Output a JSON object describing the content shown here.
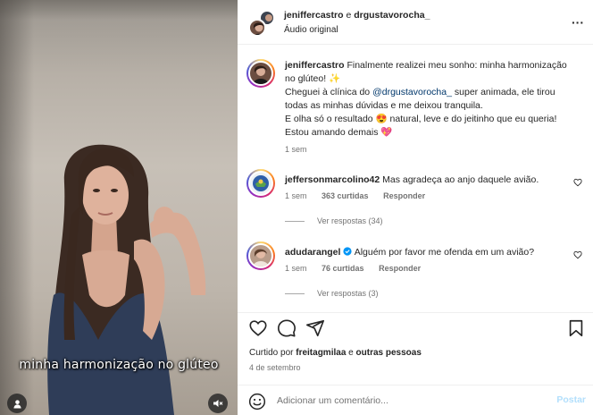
{
  "media": {
    "caption": "minha harmonização no glúteo",
    "icons": {
      "user": "user-tag-icon",
      "mute": "speaker-muted-icon"
    }
  },
  "header": {
    "user1": "jeniffercastro",
    "and_text": " e ",
    "user2": "drgustavorocha_",
    "audio": "Áudio original",
    "more": "···"
  },
  "post": {
    "username": "jeniffercastro",
    "line1": "Finalmente realizei meu sonho: minha harmonização no glúteo! ✨",
    "line2_pre": "Cheguei à clínica do ",
    "mention": "@drgustavorocha_",
    "line2_post": " super animada, ele tirou todas as minhas dúvidas e me deixou tranquila.",
    "line3": "E olha só o resultado 😍 natural, leve e do jeitinho que eu queria! Estou amando demais 💖",
    "time": "1 sem"
  },
  "comments": [
    {
      "username": "jeffersonmarcolino42",
      "text": "Mas agradeça ao anjo daquele avião.",
      "time": "1 sem",
      "likes": "363 curtidas",
      "reply": "Responder",
      "view_replies": "Ver respostas (34)"
    },
    {
      "username": "adudarangel",
      "text": "Alguém por favor me ofenda em um avião?",
      "time": "1 sem",
      "likes": "76 curtidas",
      "reply": "Responder",
      "view_replies": "Ver respostas (3)"
    }
  ],
  "footer": {
    "liked_prefix": "Curtido por ",
    "liked_user": "freitagmilaa",
    "liked_and": " e ",
    "liked_others": "outras pessoas",
    "date": "4 de setembro",
    "comment_placeholder": "Adicionar um comentário...",
    "post_label": "Postar"
  },
  "colors": {
    "link": "#00376b",
    "muted": "#737373",
    "post_disabled": "#b2dffc",
    "verified": "#0095f6"
  }
}
